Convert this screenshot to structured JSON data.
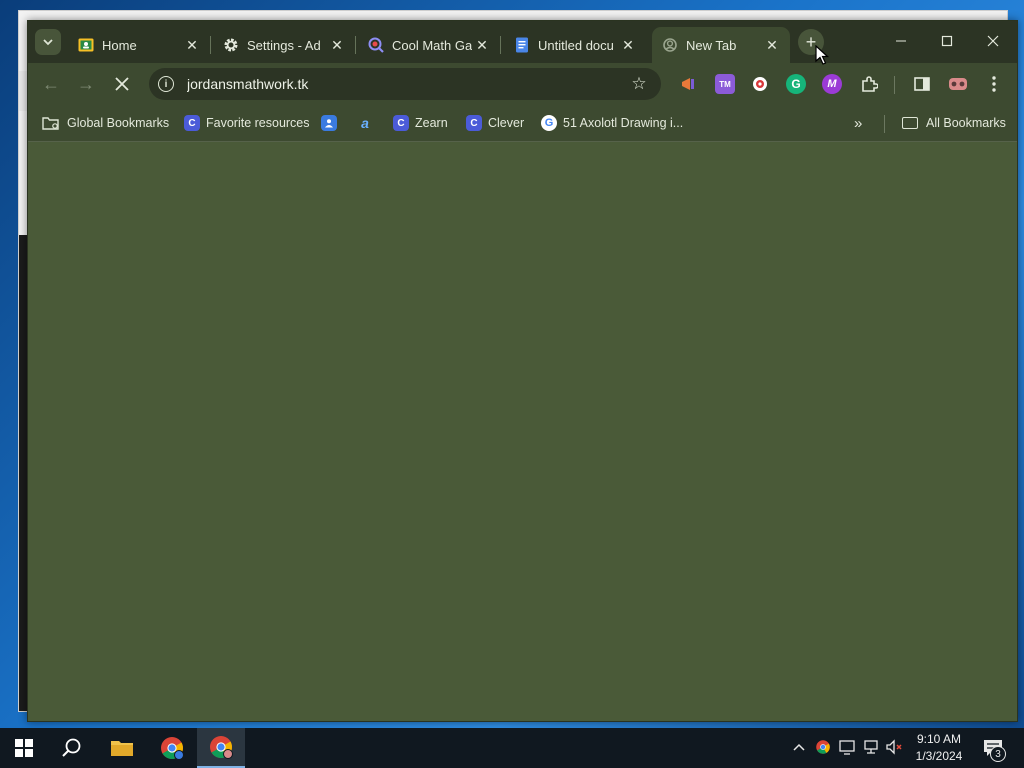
{
  "tabs": [
    {
      "title": "Home",
      "icon": "classroom-icon"
    },
    {
      "title": "Settings - Ad",
      "icon": "gear-icon"
    },
    {
      "title": "Cool Math Ga",
      "icon": "coolmath-icon"
    },
    {
      "title": "Untitled docu",
      "icon": "docs-icon"
    },
    {
      "title": "New Tab",
      "icon": "loading-icon",
      "active": true
    }
  ],
  "toolbar": {
    "url": "jordansmathwork.tk"
  },
  "bookmarks": [
    {
      "label": "Global Bookmarks"
    },
    {
      "label": "Favorite resources"
    },
    {
      "label": ""
    },
    {
      "label": ""
    },
    {
      "label": "Zearn"
    },
    {
      "label": "Clever"
    },
    {
      "label": "51 Axolotl Drawing i..."
    }
  ],
  "all_bookmarks": "All Bookmarks",
  "clock": {
    "time": "9:10 AM",
    "date": "1/3/2024"
  },
  "notifications_count": "3",
  "colors": {
    "chrome_frame": "#2c3424",
    "chrome_toolbar": "#3d4a30",
    "page_background": "#4a5a38",
    "taskbar": "#101820"
  }
}
